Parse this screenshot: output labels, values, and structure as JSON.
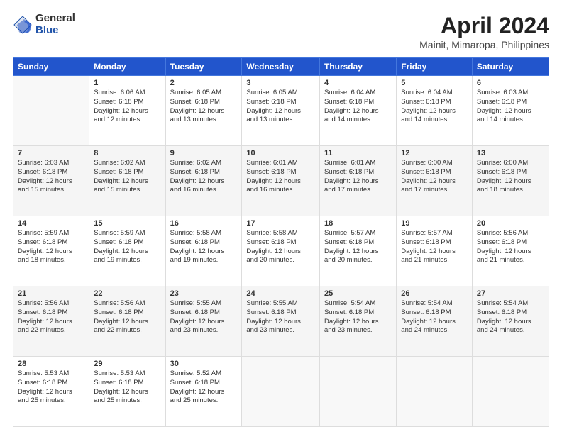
{
  "header": {
    "logo_general": "General",
    "logo_blue": "Blue",
    "title": "April 2024",
    "subtitle": "Mainit, Mimaropa, Philippines"
  },
  "days": [
    "Sunday",
    "Monday",
    "Tuesday",
    "Wednesday",
    "Thursday",
    "Friday",
    "Saturday"
  ],
  "weeks": [
    [
      {
        "date": "",
        "info": ""
      },
      {
        "date": "1",
        "info": "Sunrise: 6:06 AM\nSunset: 6:18 PM\nDaylight: 12 hours\nand 12 minutes."
      },
      {
        "date": "2",
        "info": "Sunrise: 6:05 AM\nSunset: 6:18 PM\nDaylight: 12 hours\nand 13 minutes."
      },
      {
        "date": "3",
        "info": "Sunrise: 6:05 AM\nSunset: 6:18 PM\nDaylight: 12 hours\nand 13 minutes."
      },
      {
        "date": "4",
        "info": "Sunrise: 6:04 AM\nSunset: 6:18 PM\nDaylight: 12 hours\nand 14 minutes."
      },
      {
        "date": "5",
        "info": "Sunrise: 6:04 AM\nSunset: 6:18 PM\nDaylight: 12 hours\nand 14 minutes."
      },
      {
        "date": "6",
        "info": "Sunrise: 6:03 AM\nSunset: 6:18 PM\nDaylight: 12 hours\nand 14 minutes."
      }
    ],
    [
      {
        "date": "7",
        "info": "Sunrise: 6:03 AM\nSunset: 6:18 PM\nDaylight: 12 hours\nand 15 minutes."
      },
      {
        "date": "8",
        "info": "Sunrise: 6:02 AM\nSunset: 6:18 PM\nDaylight: 12 hours\nand 15 minutes."
      },
      {
        "date": "9",
        "info": "Sunrise: 6:02 AM\nSunset: 6:18 PM\nDaylight: 12 hours\nand 16 minutes."
      },
      {
        "date": "10",
        "info": "Sunrise: 6:01 AM\nSunset: 6:18 PM\nDaylight: 12 hours\nand 16 minutes."
      },
      {
        "date": "11",
        "info": "Sunrise: 6:01 AM\nSunset: 6:18 PM\nDaylight: 12 hours\nand 17 minutes."
      },
      {
        "date": "12",
        "info": "Sunrise: 6:00 AM\nSunset: 6:18 PM\nDaylight: 12 hours\nand 17 minutes."
      },
      {
        "date": "13",
        "info": "Sunrise: 6:00 AM\nSunset: 6:18 PM\nDaylight: 12 hours\nand 18 minutes."
      }
    ],
    [
      {
        "date": "14",
        "info": "Sunrise: 5:59 AM\nSunset: 6:18 PM\nDaylight: 12 hours\nand 18 minutes."
      },
      {
        "date": "15",
        "info": "Sunrise: 5:59 AM\nSunset: 6:18 PM\nDaylight: 12 hours\nand 19 minutes."
      },
      {
        "date": "16",
        "info": "Sunrise: 5:58 AM\nSunset: 6:18 PM\nDaylight: 12 hours\nand 19 minutes."
      },
      {
        "date": "17",
        "info": "Sunrise: 5:58 AM\nSunset: 6:18 PM\nDaylight: 12 hours\nand 20 minutes."
      },
      {
        "date": "18",
        "info": "Sunrise: 5:57 AM\nSunset: 6:18 PM\nDaylight: 12 hours\nand 20 minutes."
      },
      {
        "date": "19",
        "info": "Sunrise: 5:57 AM\nSunset: 6:18 PM\nDaylight: 12 hours\nand 21 minutes."
      },
      {
        "date": "20",
        "info": "Sunrise: 5:56 AM\nSunset: 6:18 PM\nDaylight: 12 hours\nand 21 minutes."
      }
    ],
    [
      {
        "date": "21",
        "info": "Sunrise: 5:56 AM\nSunset: 6:18 PM\nDaylight: 12 hours\nand 22 minutes."
      },
      {
        "date": "22",
        "info": "Sunrise: 5:56 AM\nSunset: 6:18 PM\nDaylight: 12 hours\nand 22 minutes."
      },
      {
        "date": "23",
        "info": "Sunrise: 5:55 AM\nSunset: 6:18 PM\nDaylight: 12 hours\nand 23 minutes."
      },
      {
        "date": "24",
        "info": "Sunrise: 5:55 AM\nSunset: 6:18 PM\nDaylight: 12 hours\nand 23 minutes."
      },
      {
        "date": "25",
        "info": "Sunrise: 5:54 AM\nSunset: 6:18 PM\nDaylight: 12 hours\nand 23 minutes."
      },
      {
        "date": "26",
        "info": "Sunrise: 5:54 AM\nSunset: 6:18 PM\nDaylight: 12 hours\nand 24 minutes."
      },
      {
        "date": "27",
        "info": "Sunrise: 5:54 AM\nSunset: 6:18 PM\nDaylight: 12 hours\nand 24 minutes."
      }
    ],
    [
      {
        "date": "28",
        "info": "Sunrise: 5:53 AM\nSunset: 6:18 PM\nDaylight: 12 hours\nand 25 minutes."
      },
      {
        "date": "29",
        "info": "Sunrise: 5:53 AM\nSunset: 6:18 PM\nDaylight: 12 hours\nand 25 minutes."
      },
      {
        "date": "30",
        "info": "Sunrise: 5:52 AM\nSunset: 6:18 PM\nDaylight: 12 hours\nand 25 minutes."
      },
      {
        "date": "",
        "info": ""
      },
      {
        "date": "",
        "info": ""
      },
      {
        "date": "",
        "info": ""
      },
      {
        "date": "",
        "info": ""
      }
    ]
  ]
}
